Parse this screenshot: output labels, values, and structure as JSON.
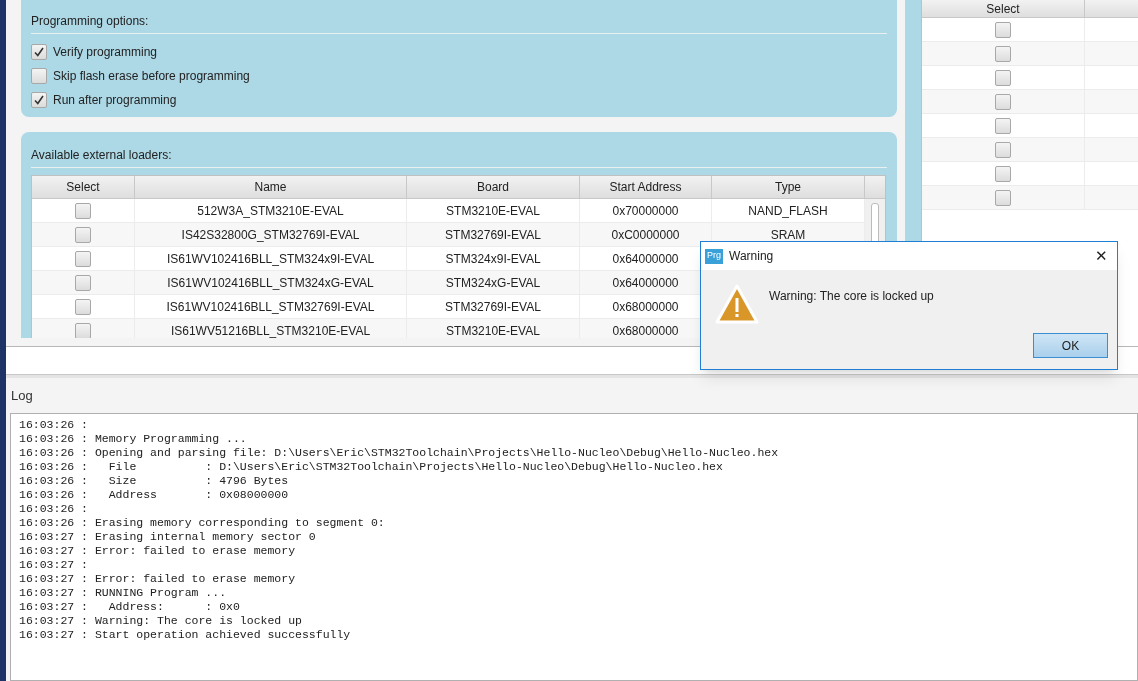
{
  "programming_options": {
    "title": "Programming options:",
    "options": [
      {
        "label": "Verify programming",
        "checked": true
      },
      {
        "label": "Skip flash erase before programming",
        "checked": false
      },
      {
        "label": "Run after programming",
        "checked": true
      }
    ]
  },
  "external_loaders": {
    "title": "Available external loaders:",
    "columns": [
      "Select",
      "Name",
      "Board",
      "Start Address",
      "Type"
    ],
    "rows": [
      {
        "checked": false,
        "name": "512W3A_STM3210E-EVAL",
        "board": "STM3210E-EVAL",
        "start_address": "0x70000000",
        "type": "NAND_FLASH"
      },
      {
        "checked": false,
        "name": "IS42S32800G_STM32769I-EVAL",
        "board": "STM32769I-EVAL",
        "start_address": "0xC0000000",
        "type": "SRAM"
      },
      {
        "checked": false,
        "name": "IS61WV102416BLL_STM324x9I-EVAL",
        "board": "STM324x9I-EVAL",
        "start_address": "0x64000000"
      },
      {
        "checked": false,
        "name": "IS61WV102416BLL_STM324xG-EVAL",
        "board": "STM324xG-EVAL",
        "start_address": "0x64000000"
      },
      {
        "checked": false,
        "name": "IS61WV102416BLL_STM32769I-EVAL",
        "board": "STM32769I-EVAL",
        "start_address": "0x68000000"
      },
      {
        "checked": false,
        "name": "IS61WV51216BLL_STM3210E-EVAL",
        "board": "STM3210E-EVAL",
        "start_address": "0x68000000"
      }
    ]
  },
  "side_table": {
    "columns": [
      "Select"
    ],
    "rows": [
      {
        "checked": false
      },
      {
        "checked": false
      },
      {
        "checked": false
      },
      {
        "checked": false
      },
      {
        "checked": false
      },
      {
        "checked": false
      },
      {
        "checked": false
      },
      {
        "checked": false
      }
    ]
  },
  "log": {
    "title": "Log",
    "lines": [
      "16:03:26 :",
      "16:03:26 : Memory Programming ...",
      "16:03:26 : Opening and parsing file: D:\\Users\\Eric\\STM32Toolchain\\Projects\\Hello-Nucleo\\Debug\\Hello-Nucleo.hex",
      "16:03:26 :   File          : D:\\Users\\Eric\\STM32Toolchain\\Projects\\Hello-Nucleo\\Debug\\Hello-Nucleo.hex",
      "16:03:26 :   Size          : 4796 Bytes",
      "16:03:26 :   Address       : 0x08000000",
      "16:03:26 :",
      "16:03:26 : Erasing memory corresponding to segment 0:",
      "16:03:27 : Erasing internal memory sector 0",
      "16:03:27 : Error: failed to erase memory",
      "16:03:27 :",
      "16:03:27 : Error: failed to erase memory",
      "16:03:27 : RUNNING Program ...",
      "16:03:27 :   Address:      : 0x0",
      "16:03:27 : Warning: The core is locked up",
      "16:03:27 : Start operation achieved successfully"
    ]
  },
  "dialog": {
    "app_badge": "Prg",
    "title": "Warning",
    "close": "✕",
    "message": "Warning: The core is locked up",
    "button": "OK"
  }
}
